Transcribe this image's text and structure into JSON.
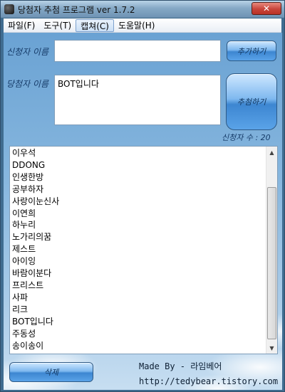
{
  "window": {
    "title": "당첨자 추첨 프로그램 ver 1.7.2",
    "close_glyph": "✕"
  },
  "menu": {
    "items": [
      "파일(F)",
      "도구(T)",
      "캡쳐(C)",
      "도움말(H)"
    ]
  },
  "form": {
    "applicant_label": "신청자 이름",
    "applicant_value": "",
    "add_button": "추가하기",
    "winner_label": "당첨자 이름",
    "winner_value": "BOT입니다",
    "draw_button": "추첨하기",
    "count_text": "신청자 수 : 20"
  },
  "list": {
    "items": [
      "이우석",
      "DDONG",
      "인생한방",
      "공부하자",
      "사랑이눈신사",
      "이연희",
      "하누리",
      "노가리의꿈",
      "제스트",
      "아이잉",
      "바람이분다",
      "프리스트",
      "사파",
      "리크",
      "BOT입니다",
      "주동성",
      "송이송이"
    ]
  },
  "footer": {
    "delete_button": "삭제",
    "made_by": "Made By - 라임베어",
    "url": "http://tedybear.tistory.com"
  },
  "icons": {
    "scroll_up": "▲",
    "scroll_down": "▼"
  }
}
